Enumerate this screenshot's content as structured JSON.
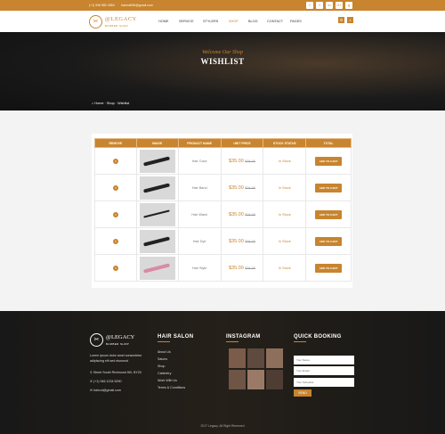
{
  "topbar": {
    "phone": "(+1) 946 582 4554",
    "email": "haircut590@gmail.com",
    "social": [
      "f",
      "t",
      "in",
      "G+",
      "g"
    ]
  },
  "header": {
    "brand": "@LEGACY",
    "tagline": "BARBER SHOP",
    "menu": [
      "HOME",
      "SERVICE",
      "STYLERS",
      "SHOP",
      "BLOG",
      "CONTACT",
      "PAGES"
    ],
    "active": "SHOP"
  },
  "hero": {
    "subtitle": "Welcome Our Shop",
    "title": "WISHLIST",
    "breadcrumb": [
      "Home",
      "Shop",
      "Wishlist"
    ]
  },
  "table": {
    "headers": [
      "REMOVE",
      "IMAGE",
      "PRODUCT NAME",
      "UNIT PRICE",
      "STOCK STATUS",
      "TOTAL"
    ],
    "rows": [
      {
        "name": "Hair Color",
        "price": "$35.00",
        "old": "$34.00",
        "stock": "In Stock",
        "btn": "ADD TO CART"
      },
      {
        "name": "Hair Band",
        "price": "$35.00",
        "old": "$34.00",
        "stock": "In Stock",
        "btn": "ADD TO CART"
      },
      {
        "name": "Hair Wash",
        "price": "$35.00",
        "old": "$34.00",
        "stock": "In Stock",
        "btn": "ADD TO CART"
      },
      {
        "name": "Hair Dye",
        "price": "$35.00",
        "old": "$34.00",
        "stock": "In Stock",
        "btn": "ADD TO CART"
      },
      {
        "name": "Hair Style",
        "price": "$35.00",
        "old": "$34.00",
        "stock": "In Stock",
        "btn": "ADD TO CART"
      }
    ]
  },
  "footer": {
    "brand": "@LEGACY",
    "tagline": "BARBER SHOP",
    "desc": "Lorem ipsum dolor amet consectetur adipiscing elit sed eiusmod",
    "address": "Street South Richmond Hill, NY20",
    "phone": "(+1) 946 1234 5290",
    "email": "haircut@gmail.com",
    "hair_salon": {
      "title": "HAIR SALON",
      "links": [
        "About Us",
        "Salons",
        "Shop",
        "Cabinetry",
        "Work With Us",
        "Terms & Conditions"
      ]
    },
    "instagram": {
      "title": "INSTAGRAM"
    },
    "booking": {
      "title": "QUICK BOOKING",
      "fields": [
        "Your Name",
        "Your Email",
        "Your Schedule"
      ],
      "button": "SEND"
    },
    "copyright": "2017 Legacy. All Right Reserved"
  }
}
